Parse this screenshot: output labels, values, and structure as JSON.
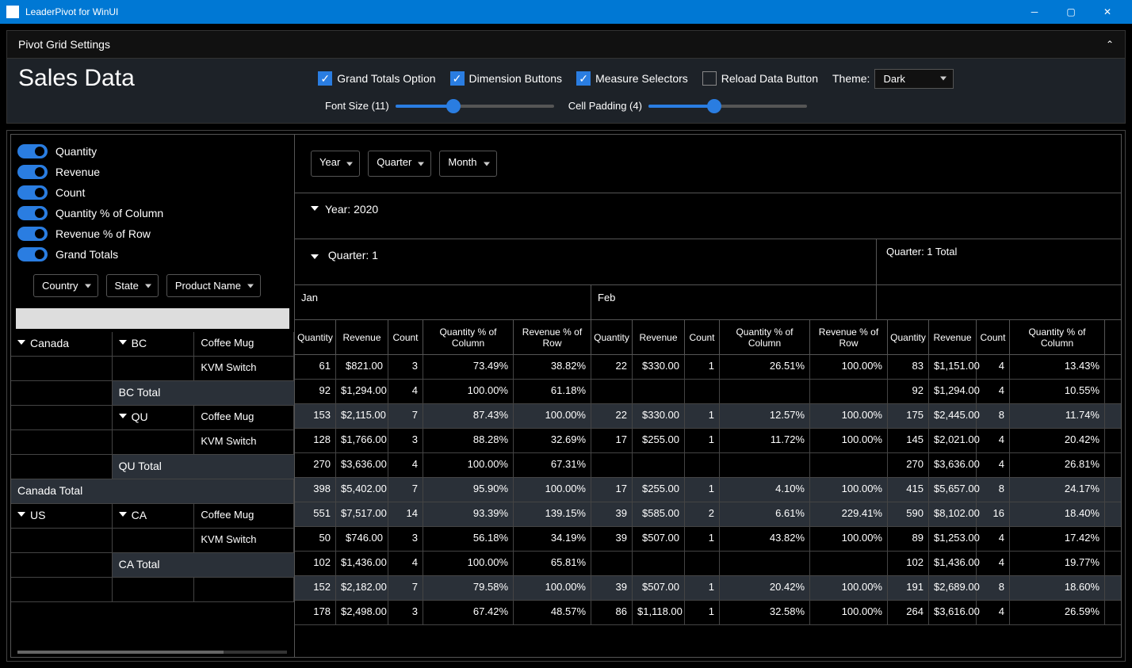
{
  "window_title": "LeaderPivot for WinUI",
  "settings_header": "Pivot Grid Settings",
  "heading": "Sales Data",
  "checkboxes": {
    "grand_totals": {
      "label": "Grand Totals Option",
      "checked": true
    },
    "dimension_buttons": {
      "label": "Dimension Buttons",
      "checked": true
    },
    "measure_selectors": {
      "label": "Measure Selectors",
      "checked": true
    },
    "reload_data": {
      "label": "Reload Data Button",
      "checked": false
    }
  },
  "theme_label": "Theme:",
  "theme_value": "Dark",
  "font_size_label": "Font Size (11)",
  "cell_padding_label": "Cell Padding (4)",
  "measures": [
    {
      "label": "Quantity"
    },
    {
      "label": "Revenue"
    },
    {
      "label": "Count"
    },
    {
      "label": "Quantity % of Column"
    },
    {
      "label": "Revenue % of Row"
    },
    {
      "label": "Grand Totals"
    }
  ],
  "row_dimensions": [
    {
      "label": "Country"
    },
    {
      "label": "State"
    },
    {
      "label": "Product Name"
    }
  ],
  "col_dimensions": [
    {
      "label": "Year"
    },
    {
      "label": "Quarter"
    },
    {
      "label": "Month"
    }
  ],
  "year_header": "Year: 2020",
  "quarter_header": "Quarter: 1",
  "quarter_total_header": "Quarter: 1 Total",
  "months": [
    "Jan",
    "Feb"
  ],
  "value_headers": [
    "Quantity",
    "Revenue",
    "Count",
    "Quantity % of Column",
    "Revenue % of Row"
  ],
  "value_headers_total": [
    "Quantity",
    "Revenue",
    "Count",
    "Quantity % of Column"
  ],
  "col_widths": {
    "qty": 52,
    "rev": 66,
    "cnt": 44,
    "qpc": 114,
    "rpr": 98,
    "tqty": 52,
    "trev": 60,
    "tcnt": 42,
    "tqpc": 120
  },
  "rows": [
    {
      "type": "data",
      "country": "Canada",
      "country_span": true,
      "state": "BC",
      "state_span": true,
      "product": "Coffee Mug",
      "jan": {
        "qty": "61",
        "rev": "$821.00",
        "cnt": "3",
        "qpc": "73.49%",
        "rpr": "38.82%"
      },
      "feb": {
        "qty": "22",
        "rev": "$330.00",
        "cnt": "1",
        "qpc": "26.51%",
        "rpr": "100.00%"
      },
      "tot": {
        "qty": "83",
        "rev": "$1,151.00",
        "cnt": "4",
        "qpc": "13.43%"
      }
    },
    {
      "type": "data",
      "product": "KVM Switch",
      "jan": {
        "qty": "92",
        "rev": "$1,294.00",
        "cnt": "4",
        "qpc": "100.00%",
        "rpr": "61.18%"
      },
      "feb": {
        "qty": "",
        "rev": "",
        "cnt": "",
        "qpc": "",
        "rpr": ""
      },
      "tot": {
        "qty": "92",
        "rev": "$1,294.00",
        "cnt": "4",
        "qpc": "10.55%"
      }
    },
    {
      "type": "state_total",
      "label": "BC Total",
      "jan": {
        "qty": "153",
        "rev": "$2,115.00",
        "cnt": "7",
        "qpc": "87.43%",
        "rpr": "100.00%"
      },
      "feb": {
        "qty": "22",
        "rev": "$330.00",
        "cnt": "1",
        "qpc": "12.57%",
        "rpr": "100.00%"
      },
      "tot": {
        "qty": "175",
        "rev": "$2,445.00",
        "cnt": "8",
        "qpc": "11.74%"
      }
    },
    {
      "type": "data",
      "state": "QU",
      "state_span": true,
      "product": "Coffee Mug",
      "jan": {
        "qty": "128",
        "rev": "$1,766.00",
        "cnt": "3",
        "qpc": "88.28%",
        "rpr": "32.69%"
      },
      "feb": {
        "qty": "17",
        "rev": "$255.00",
        "cnt": "1",
        "qpc": "11.72%",
        "rpr": "100.00%"
      },
      "tot": {
        "qty": "145",
        "rev": "$2,021.00",
        "cnt": "4",
        "qpc": "20.42%"
      }
    },
    {
      "type": "data",
      "product": "KVM Switch",
      "jan": {
        "qty": "270",
        "rev": "$3,636.00",
        "cnt": "4",
        "qpc": "100.00%",
        "rpr": "67.31%"
      },
      "feb": {
        "qty": "",
        "rev": "",
        "cnt": "",
        "qpc": "",
        "rpr": ""
      },
      "tot": {
        "qty": "270",
        "rev": "$3,636.00",
        "cnt": "4",
        "qpc": "26.81%"
      }
    },
    {
      "type": "state_total",
      "label": "QU Total",
      "jan": {
        "qty": "398",
        "rev": "$5,402.00",
        "cnt": "7",
        "qpc": "95.90%",
        "rpr": "100.00%"
      },
      "feb": {
        "qty": "17",
        "rev": "$255.00",
        "cnt": "1",
        "qpc": "4.10%",
        "rpr": "100.00%"
      },
      "tot": {
        "qty": "415",
        "rev": "$5,657.00",
        "cnt": "8",
        "qpc": "24.17%"
      }
    },
    {
      "type": "country_total",
      "label": "Canada Total",
      "jan": {
        "qty": "551",
        "rev": "$7,517.00",
        "cnt": "14",
        "qpc": "93.39%",
        "rpr": "139.15%"
      },
      "feb": {
        "qty": "39",
        "rev": "$585.00",
        "cnt": "2",
        "qpc": "6.61%",
        "rpr": "229.41%"
      },
      "tot": {
        "qty": "590",
        "rev": "$8,102.00",
        "cnt": "16",
        "qpc": "18.40%"
      }
    },
    {
      "type": "data",
      "country": "US",
      "country_span": true,
      "state": "CA",
      "state_span": true,
      "product": "Coffee Mug",
      "jan": {
        "qty": "50",
        "rev": "$746.00",
        "cnt": "3",
        "qpc": "56.18%",
        "rpr": "34.19%"
      },
      "feb": {
        "qty": "39",
        "rev": "$507.00",
        "cnt": "1",
        "qpc": "43.82%",
        "rpr": "100.00%"
      },
      "tot": {
        "qty": "89",
        "rev": "$1,253.00",
        "cnt": "4",
        "qpc": "17.42%"
      }
    },
    {
      "type": "data",
      "product": "KVM Switch",
      "jan": {
        "qty": "102",
        "rev": "$1,436.00",
        "cnt": "4",
        "qpc": "100.00%",
        "rpr": "65.81%"
      },
      "feb": {
        "qty": "",
        "rev": "",
        "cnt": "",
        "qpc": "",
        "rpr": ""
      },
      "tot": {
        "qty": "102",
        "rev": "$1,436.00",
        "cnt": "4",
        "qpc": "19.77%"
      }
    },
    {
      "type": "state_total",
      "label": "CA Total",
      "jan": {
        "qty": "152",
        "rev": "$2,182.00",
        "cnt": "7",
        "qpc": "79.58%",
        "rpr": "100.00%"
      },
      "feb": {
        "qty": "39",
        "rev": "$507.00",
        "cnt": "1",
        "qpc": "20.42%",
        "rpr": "100.00%"
      },
      "tot": {
        "qty": "191",
        "rev": "$2,689.00",
        "cnt": "8",
        "qpc": "18.60%"
      }
    },
    {
      "type": "partial",
      "label": "",
      "jan": {
        "qty": "178",
        "rev": "$2,498.00",
        "cnt": "3",
        "qpc": "67.42%",
        "rpr": "48.57%"
      },
      "feb": {
        "qty": "86",
        "rev": "$1,118.00",
        "cnt": "1",
        "qpc": "32.58%",
        "rpr": "100.00%"
      },
      "tot": {
        "qty": "264",
        "rev": "$3,616.00",
        "cnt": "4",
        "qpc": "26.59%"
      }
    }
  ]
}
